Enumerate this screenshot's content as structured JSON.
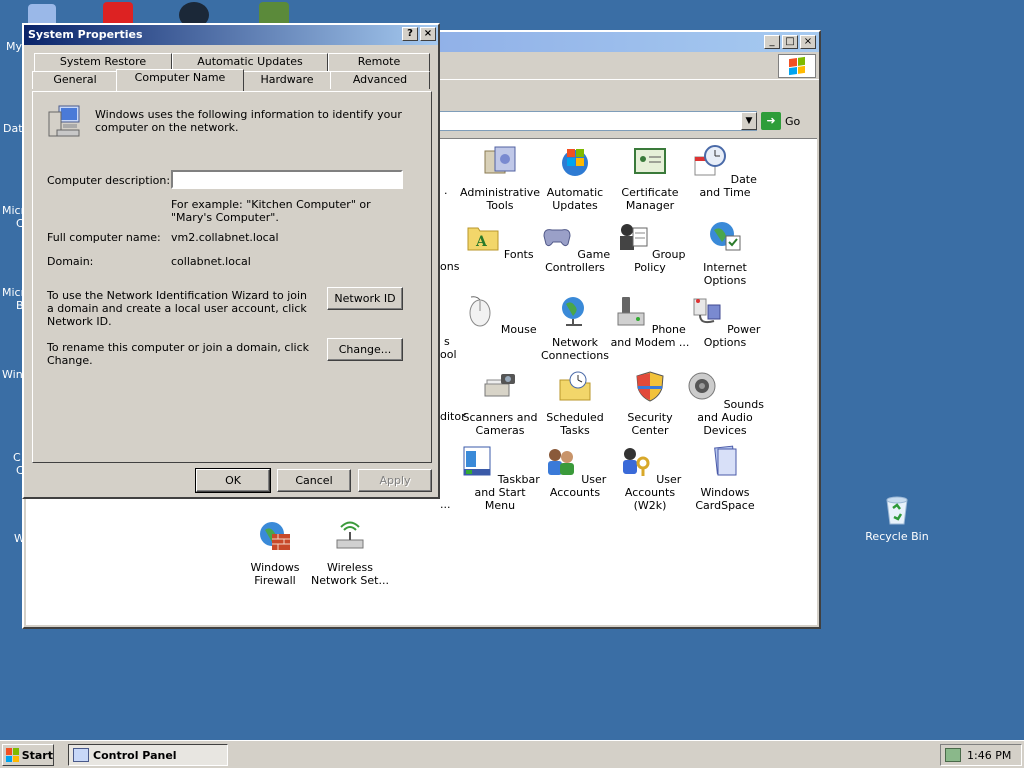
{
  "desktop": {
    "partial_labels": [
      "My",
      "Dat",
      "Micro",
      "C",
      "Micro",
      "B",
      "Wind",
      "C",
      "C",
      "W"
    ],
    "recycle_bin": "Recycle Bin"
  },
  "control_panel": {
    "title": "Control Panel",
    "go_label": "Go",
    "partial_labels": [
      ".",
      "ons",
      "s",
      "ool",
      "ditor",
      "..."
    ],
    "items": [
      {
        "label": "Administrative Tools",
        "icon": "administrative-tools-icon"
      },
      {
        "label": "Automatic Updates",
        "icon": "automatic-updates-icon"
      },
      {
        "label": "Certificate Manager",
        "icon": "certificate-icon"
      },
      {
        "label": "Date and Time",
        "icon": "clock-icon"
      },
      {
        "label": "Fonts",
        "icon": "fonts-folder-icon"
      },
      {
        "label": "Game Controllers",
        "icon": "gamepad-icon"
      },
      {
        "label": "Group Policy",
        "icon": "group-policy-icon"
      },
      {
        "label": "Internet Options",
        "icon": "globe-icon"
      },
      {
        "label": "Mouse",
        "icon": "mouse-icon"
      },
      {
        "label": "Network Connections",
        "icon": "network-globe-icon"
      },
      {
        "label": "Phone and Modem ...",
        "icon": "phone-icon"
      },
      {
        "label": "Power Options",
        "icon": "power-plug-icon"
      },
      {
        "label": "Scanners and Cameras",
        "icon": "scanner-icon"
      },
      {
        "label": "Scheduled Tasks",
        "icon": "scheduled-tasks-folder-icon"
      },
      {
        "label": "Security Center",
        "icon": "shield-icon"
      },
      {
        "label": "Sounds and Audio Devices",
        "icon": "speaker-icon"
      },
      {
        "label": "Taskbar and Start Menu",
        "icon": "taskbar-icon"
      },
      {
        "label": "User Accounts",
        "icon": "users-icon"
      },
      {
        "label": "User Accounts (W2k)",
        "icon": "users-key-icon"
      },
      {
        "label": "Windows CardSpace",
        "icon": "cardspace-icon"
      },
      {
        "label": "Windows Firewall",
        "icon": "firewall-icon"
      },
      {
        "label": "Wireless Network Set...",
        "icon": "wireless-icon"
      }
    ]
  },
  "dialog": {
    "title": "System Properties",
    "help_button": "?",
    "close_button": "×",
    "tabs_back": [
      "System Restore",
      "Automatic Updates",
      "Remote"
    ],
    "tabs_front": [
      "General",
      "Computer Name",
      "Hardware",
      "Advanced"
    ],
    "active_tab": "Computer Name",
    "intro": "Windows uses the following information to identify your computer on the network.",
    "computer_description_label": "Computer description:",
    "computer_description_value": "",
    "example": "For example: \"Kitchen Computer\" or \"Mary's Computer\".",
    "full_name_label": "Full computer name:",
    "full_name_value": "vm2.collabnet.local",
    "domain_label": "Domain:",
    "domain_value": "collabnet.local",
    "network_id_text": "To use the Network Identification Wizard to join a domain and create a local user account, click Network ID.",
    "network_id_button": "Network ID",
    "rename_text": "To rename this computer or join a domain, click Change.",
    "change_button": "Change...",
    "ok_button": "OK",
    "cancel_button": "Cancel",
    "apply_button": "Apply"
  },
  "taskbar": {
    "start_label": "Start",
    "task_label": "Control Panel",
    "clock": "1:46 PM"
  }
}
